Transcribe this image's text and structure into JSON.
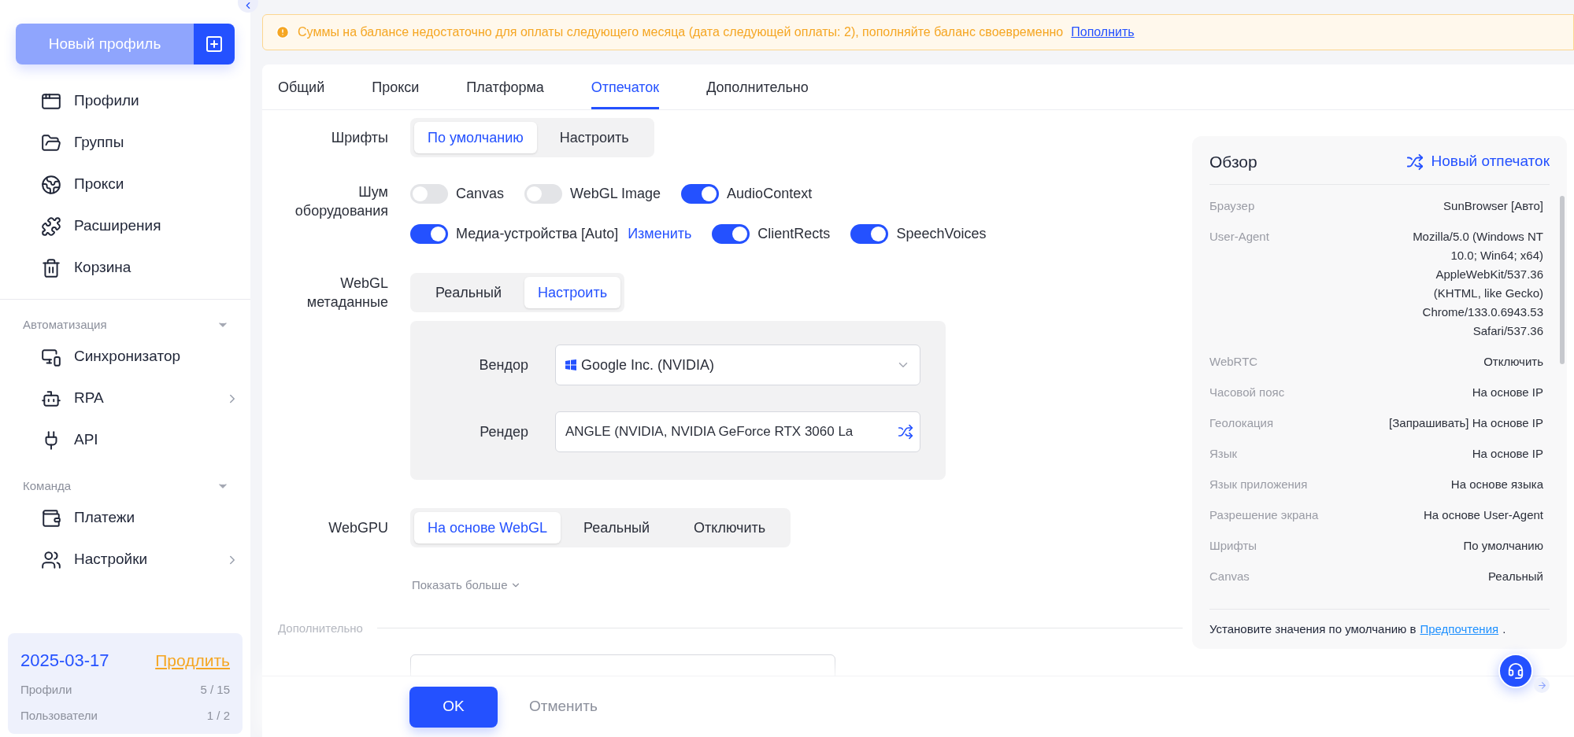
{
  "sidebar": {
    "new_profile_button": "Новый профиль",
    "primary_nav": [
      {
        "label": "Профили"
      },
      {
        "label": "Группы"
      },
      {
        "label": "Прокси"
      },
      {
        "label": "Расширения"
      },
      {
        "label": "Корзина"
      }
    ],
    "sections": [
      {
        "title": "Автоматизация",
        "items": [
          {
            "label": "Синхронизатор",
            "has_submenu": false
          },
          {
            "label": "RPA",
            "has_submenu": true
          },
          {
            "label": "API",
            "has_submenu": false
          }
        ]
      },
      {
        "title": "Команда",
        "items": [
          {
            "label": "Платежи",
            "has_submenu": false
          },
          {
            "label": "Настройки",
            "has_submenu": true
          }
        ]
      }
    ],
    "plan": {
      "expiry_date": "2025-03-17",
      "renew_link": "Продлить",
      "stats": [
        {
          "label": "Профили",
          "value": "5 / 15"
        },
        {
          "label": "Пользователи",
          "value": "1 / 2"
        }
      ]
    }
  },
  "banner": {
    "text": "Суммы на балансе недостаточно для оплаты следующего месяца (дата следующей оплаты: 2), пополняйте баланс своевременно",
    "link": "Пополнить"
  },
  "tabs": [
    {
      "label": "Общий",
      "selected": false
    },
    {
      "label": "Прокси",
      "selected": false
    },
    {
      "label": "Платформа",
      "selected": false
    },
    {
      "label": "Отпечаток",
      "selected": true
    },
    {
      "label": "Дополнительно",
      "selected": false
    }
  ],
  "form": {
    "rows": [
      {
        "kind": "segmented",
        "label": "Шрифты",
        "options": [
          {
            "label": "По умолчанию",
            "selected": true
          },
          {
            "label": "Настроить",
            "selected": false
          }
        ]
      },
      {
        "kind": "toggles",
        "label": "Шум оборудования",
        "lines": [
          [
            {
              "label": "Canvas",
              "on": false
            },
            {
              "label": "WebGL Image",
              "on": false
            },
            {
              "label": "AudioContext",
              "on": true
            }
          ],
          [
            {
              "label": "Медиа-устройства [Auto]",
              "on": true,
              "link": "Изменить"
            },
            {
              "label": "ClientRects",
              "on": true
            },
            {
              "label": "SpeechVoices",
              "on": true
            }
          ]
        ]
      },
      {
        "kind": "segmented",
        "label": "WebGL метаданные",
        "options": [
          {
            "label": "Реальный",
            "selected": false
          },
          {
            "label": "Настроить",
            "selected": true
          }
        ],
        "panel": {
          "vendor_label": "Вендор",
          "vendor_value": "Google Inc. (NVIDIA)",
          "renderer_label": "Рендер",
          "renderer_value": "ANGLE (NVIDIA, NVIDIA GeForce RTX 3060 La"
        }
      },
      {
        "kind": "segmented",
        "label": "WebGPU",
        "options": [
          {
            "label": "На основе WebGL",
            "selected": true
          },
          {
            "label": "Реальный",
            "selected": false
          },
          {
            "label": "Отключить",
            "selected": false
          }
        ]
      }
    ],
    "show_more": "Показать больше",
    "section_title": "Дополнительно"
  },
  "footer": {
    "ok": "OK",
    "cancel": "Отменить"
  },
  "overview": {
    "title": "Обзор",
    "action": "Новый отпечаток",
    "rows": [
      {
        "label": "Браузер",
        "value": "SunBrowser [Авто]"
      },
      {
        "label": "User-Agent",
        "value": "Mozilla/5.0 (Windows NT 10.0; Win64; x64) AppleWebKit/537.36 (KHTML, like Gecko) Chrome/133.0.6943.53 Safari/537.36"
      },
      {
        "label": "WebRTC",
        "value": "Отключить"
      },
      {
        "label": "Часовой пояс",
        "value": "На основе IP"
      },
      {
        "label": "Геолокация",
        "value": "[Запрашивать] На основе IP"
      },
      {
        "label": "Язык",
        "value": "На основе IP"
      },
      {
        "label": "Язык приложения",
        "value": "На основе языка"
      },
      {
        "label": "Разрешение экрана",
        "value": "На основе User-Agent"
      },
      {
        "label": "Шрифты",
        "value": "По умолчанию"
      },
      {
        "label": "Canvas",
        "value": "Реальный"
      }
    ],
    "note": "Установите значения по умолчанию в",
    "note_link": "Предпочтения",
    "note_end": "."
  }
}
